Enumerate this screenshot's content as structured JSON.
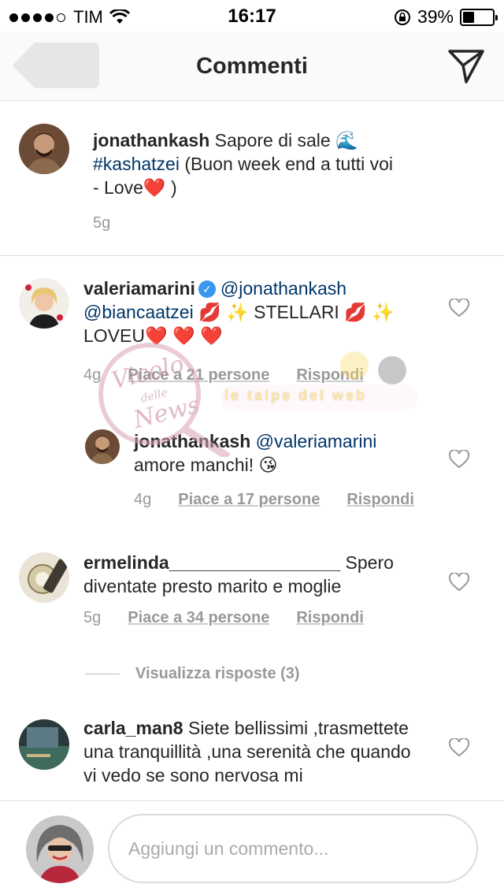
{
  "status_bar": {
    "carrier": "TIM",
    "time": "16:17",
    "battery_percent": "39%",
    "battery_level": 0.39,
    "signal_bars_filled": 4,
    "signal_bars_total": 5,
    "icons": [
      "wifi-icon",
      "orientation-lock-icon",
      "battery-icon"
    ]
  },
  "nav": {
    "title": "Commenti",
    "back_icon": "back-arrow-icon",
    "direct_icon": "paper-plane-icon"
  },
  "caption": {
    "username": "jonathankash",
    "text_1": " Sapore di sale 🌊",
    "hashtag": "#kashatzei",
    "text_2": " (Buon week end a tutti voi - Love❤️ )",
    "time": "5g"
  },
  "comments": [
    {
      "username": "valeriamarini",
      "verified": true,
      "mention_1": "@jonathankash",
      "mention_2": "@biancaatzei",
      "text": " 💋 ✨ STELLARI 💋 ✨ LOVEU❤️ ❤️ ❤️",
      "time": "4g",
      "likes": "Piace a 21 persone",
      "reply": "Rispondi"
    },
    {
      "username": "jonathankash",
      "mention": "@valeriamarini",
      "text": "amore manchi! 😘",
      "time": "4g",
      "likes": "Piace a 17 persone",
      "reply": "Rispondi"
    },
    {
      "username": "ermelinda_________________",
      "text": " Spero diventate presto marito e moglie",
      "time": "5g",
      "likes": "Piace a 34 persone",
      "reply": "Rispondi",
      "view_replies": "Visualizza risposte (3)"
    },
    {
      "username": "carla_man8",
      "text": " Siete bellissimi ,trasmettete una tranquillità ,una serenità che quando vi vedo se sono nervosa mi"
    }
  ],
  "watermark": {
    "script_text": "Vicolo delle News",
    "band_text": "le talpe del web"
  },
  "composer": {
    "placeholder": "Aggiungi un commento..."
  },
  "colors": {
    "link_blue": "#003569",
    "verified_blue": "#3897f0",
    "meta_grey": "#999999",
    "divider": "#dbdbdb"
  }
}
